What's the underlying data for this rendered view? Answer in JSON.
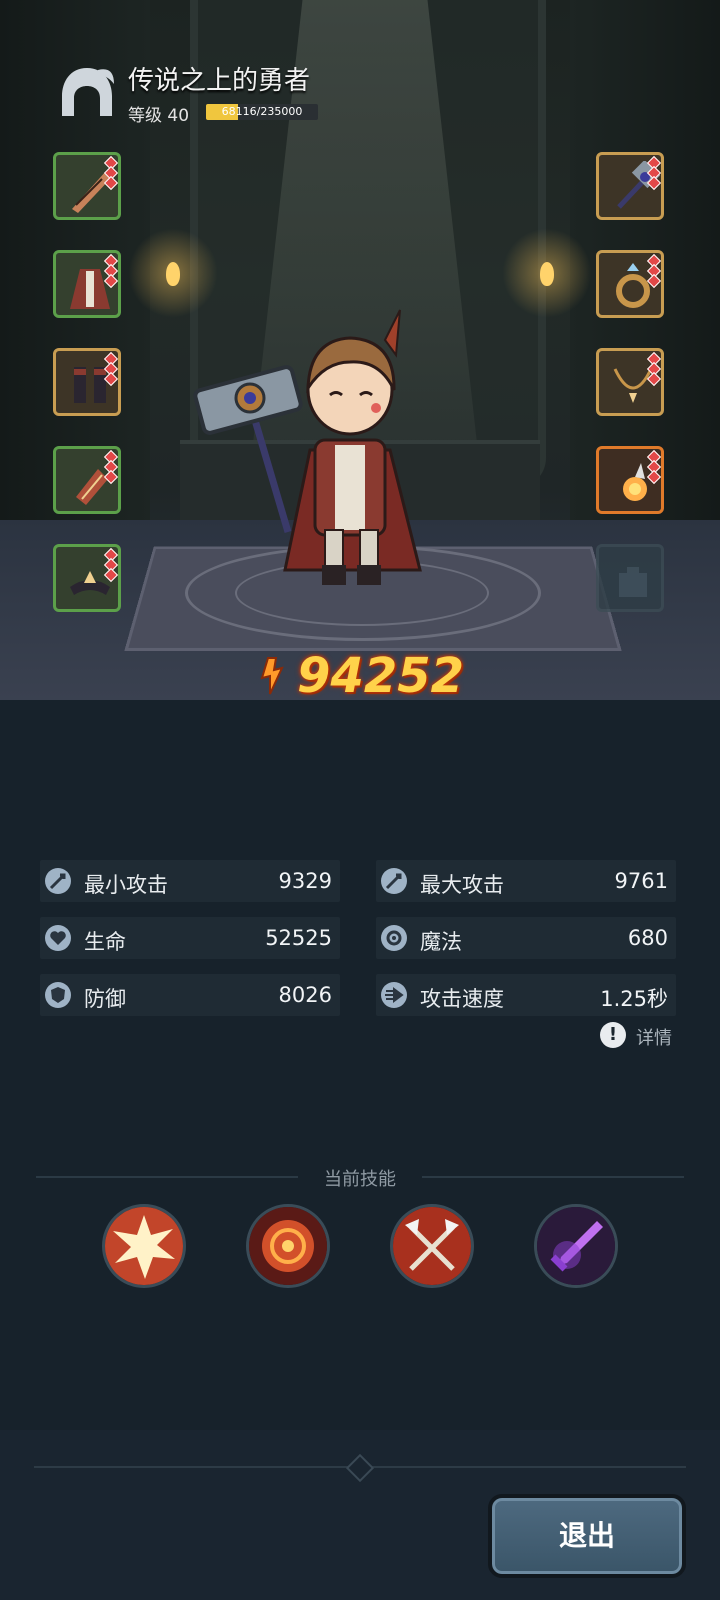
{
  "player": {
    "title": "传说之上的勇者",
    "level_label": "等级 40",
    "xp_text": "68116/235000",
    "xp_progress": 0.29
  },
  "equipment": {
    "left": [
      {
        "name": "feather",
        "icon": "feather-icon",
        "border": "green"
      },
      {
        "name": "robe",
        "icon": "robe-icon",
        "border": "green"
      },
      {
        "name": "boots",
        "icon": "boots-icon",
        "border": "gold"
      },
      {
        "name": "bracer",
        "icon": "bracer-icon",
        "border": "green"
      },
      {
        "name": "tiara",
        "icon": "tiara-icon",
        "border": "green"
      }
    ],
    "right": [
      {
        "name": "hammer",
        "icon": "hammer-icon",
        "border": "gold"
      },
      {
        "name": "ring",
        "icon": "ring-icon",
        "border": "gold"
      },
      {
        "name": "necklace",
        "icon": "necklace-icon",
        "border": "gold"
      },
      {
        "name": "flame-charm",
        "icon": "flame-charm-icon",
        "border": "orange"
      },
      {
        "name": "empty-slot",
        "icon": "empty-slot-icon",
        "border": "empty"
      }
    ]
  },
  "power": {
    "value": "94252",
    "icon": "combat-power-icon"
  },
  "stats": {
    "min_attack": {
      "label": "最小攻击",
      "value": "9329",
      "icon": "sword-icon"
    },
    "max_attack": {
      "label": "最大攻击",
      "value": "9761",
      "icon": "sword-icon"
    },
    "hp": {
      "label": "生命",
      "value": "52525",
      "icon": "heart-icon"
    },
    "magic": {
      "label": "魔法",
      "value": "680",
      "icon": "magic-icon"
    },
    "defense": {
      "label": "防御",
      "value": "8026",
      "icon": "shield-icon"
    },
    "attack_speed": {
      "label": "攻击速度",
      "value": "1.25秒",
      "icon": "speed-icon"
    }
  },
  "detail_label": "详情",
  "skills": {
    "title": "当前技能",
    "items": [
      {
        "icon": "explosion-skill-icon",
        "color": "#f3c24a"
      },
      {
        "icon": "fire-vortex-skill-icon",
        "color": "#d2502a"
      },
      {
        "icon": "crossed-axes-skill-icon",
        "color": "#c2452a"
      },
      {
        "icon": "shadow-blade-skill-icon",
        "color": "#8a3fd0"
      }
    ]
  },
  "exit_label": "退出",
  "colors": {
    "background": "#17222b",
    "power": "#ffd24a",
    "xp_fill": "#f0c63e",
    "button": "#3a5568"
  }
}
